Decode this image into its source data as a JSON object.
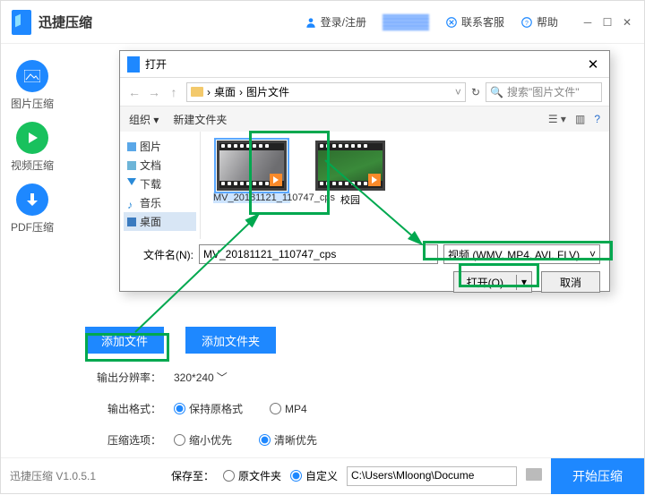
{
  "app": {
    "name": "迅捷压缩",
    "version": "迅捷压缩 V1.0.5.1"
  },
  "header": {
    "login": "登录/注册",
    "contact": "联系客服",
    "help": "帮助"
  },
  "sidebar": [
    {
      "label": "图片压缩"
    },
    {
      "label": "视频压缩"
    },
    {
      "label": "PDF压缩"
    }
  ],
  "buttons": {
    "add_file": "添加文件",
    "add_folder": "添加文件夹",
    "start": "开始压缩"
  },
  "opts": {
    "resolution_label": "输出分辨率：",
    "resolution_value": "320*240",
    "format_label": "输出格式：",
    "format_keep": "保持原格式",
    "format_mp4": "MP4",
    "compress_label": "压缩选项：",
    "compress_small": "缩小优先",
    "compress_clear": "清晰优先"
  },
  "footer": {
    "save_label": "保存至：",
    "orig": "原文件夹",
    "custom": "自定义",
    "path": "C:\\Users\\Mloong\\Docume"
  },
  "dialog": {
    "title": "打开",
    "crumb1": "桌面",
    "crumb2": "图片文件",
    "search_ph": "搜索\"图片文件\"",
    "organize": "组织",
    "new_folder": "新建文件夹",
    "tree": [
      "图片",
      "文档",
      "下载",
      "音乐",
      "桌面"
    ],
    "file1": "MV_20181121_110747_cps",
    "file2": "校园",
    "filename_label": "文件名(N):",
    "filename_value": "MV_20181121_110747_cps",
    "filetype": "视频 (WMV, MP4, AVI, FLV)",
    "open": "打开(O)",
    "cancel": "取消"
  }
}
